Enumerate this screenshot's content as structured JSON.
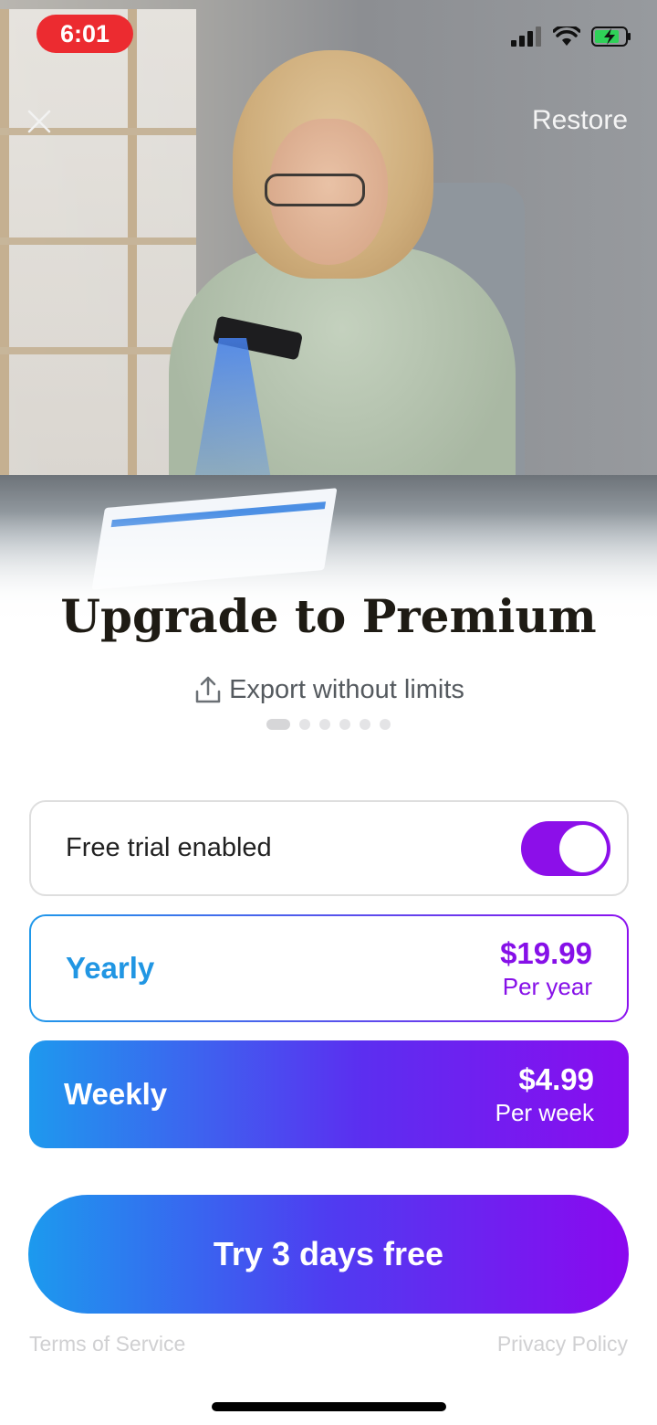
{
  "status_bar": {
    "time": "6:01",
    "icons": [
      "cellular-signal-icon",
      "wifi-icon",
      "battery-charging-icon"
    ]
  },
  "header": {
    "close_icon": "close-icon",
    "restore_label": "Restore"
  },
  "hero": {
    "image": "woman-scanning-document-photo"
  },
  "title": "Upgrade to Premium",
  "feature": {
    "icon": "share-upload-icon",
    "label": "Export without limits"
  },
  "carousel": {
    "page_count": 6,
    "active_index": 0
  },
  "trial": {
    "label": "Free trial enabled",
    "enabled": true
  },
  "plans": [
    {
      "name": "Yearly",
      "price": "$19.99",
      "period": "Per year",
      "selected": false
    },
    {
      "name": "Weekly",
      "price": "$4.99",
      "period": "Per week",
      "selected": true
    }
  ],
  "cta_label": "Try 3 days free",
  "footer": {
    "terms_label": "Terms of Service",
    "privacy_label": "Privacy Policy"
  },
  "colors": {
    "accent_purple": "#8b10ef",
    "accent_blue": "#1f98ea",
    "time_pill": "#ec2b30"
  }
}
